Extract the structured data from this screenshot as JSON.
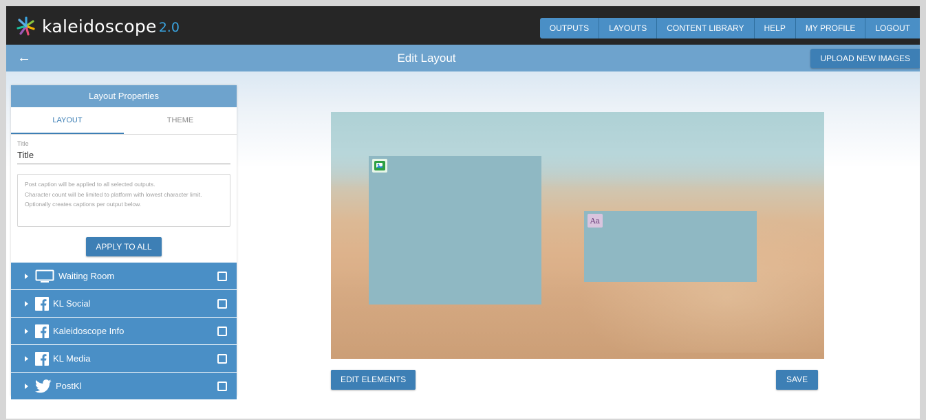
{
  "app": {
    "logo_text": "kaleidoscope",
    "logo_version": "2.0"
  },
  "nav": {
    "items": [
      "OUTPUTS",
      "LAYOUTS",
      "CONTENT LIBRARY",
      "HELP",
      "MY PROFILE",
      "LOGOUT"
    ]
  },
  "header": {
    "back_icon": "arrow-left-icon",
    "title": "Edit Layout",
    "upload_label": "UPLOAD NEW IMAGES"
  },
  "panel": {
    "header": "Layout Properties",
    "tabs": [
      {
        "label": "LAYOUT",
        "active": true
      },
      {
        "label": "THEME",
        "active": false
      }
    ],
    "title_field": {
      "label": "Title",
      "value": "Title"
    },
    "caption_placeholder": [
      "Post caption will be applied to all selected outputs.",
      "Character count will be limited to platform with lowest character limit.",
      "Optionally creates captions per output below."
    ],
    "apply_label": "APPLY TO ALL"
  },
  "outputs": [
    {
      "label": "Waiting Room",
      "icon": "monitor-icon",
      "checked": false
    },
    {
      "label": "KL Social",
      "icon": "facebook-icon",
      "checked": false
    },
    {
      "label": "Kaleidoscope Info",
      "icon": "facebook-icon",
      "checked": false
    },
    {
      "label": "KL Media",
      "icon": "facebook-icon",
      "checked": false
    },
    {
      "label": "PostKl",
      "icon": "twitter-icon",
      "checked": false
    }
  ],
  "canvas": {
    "elements": [
      {
        "type": "image",
        "icon": "image-element-icon"
      },
      {
        "type": "text",
        "icon": "text-element-icon",
        "glyph": "Aa"
      }
    ]
  },
  "actions": {
    "edit_label": "EDIT ELEMENTS",
    "save_label": "SAVE"
  },
  "colors": {
    "nav_dark": "#262626",
    "accent_blue": "#4a8fc6",
    "button_blue": "#3d7fb5",
    "subbar_blue": "#6ea3cd",
    "version_blue": "#3aa4e0"
  }
}
